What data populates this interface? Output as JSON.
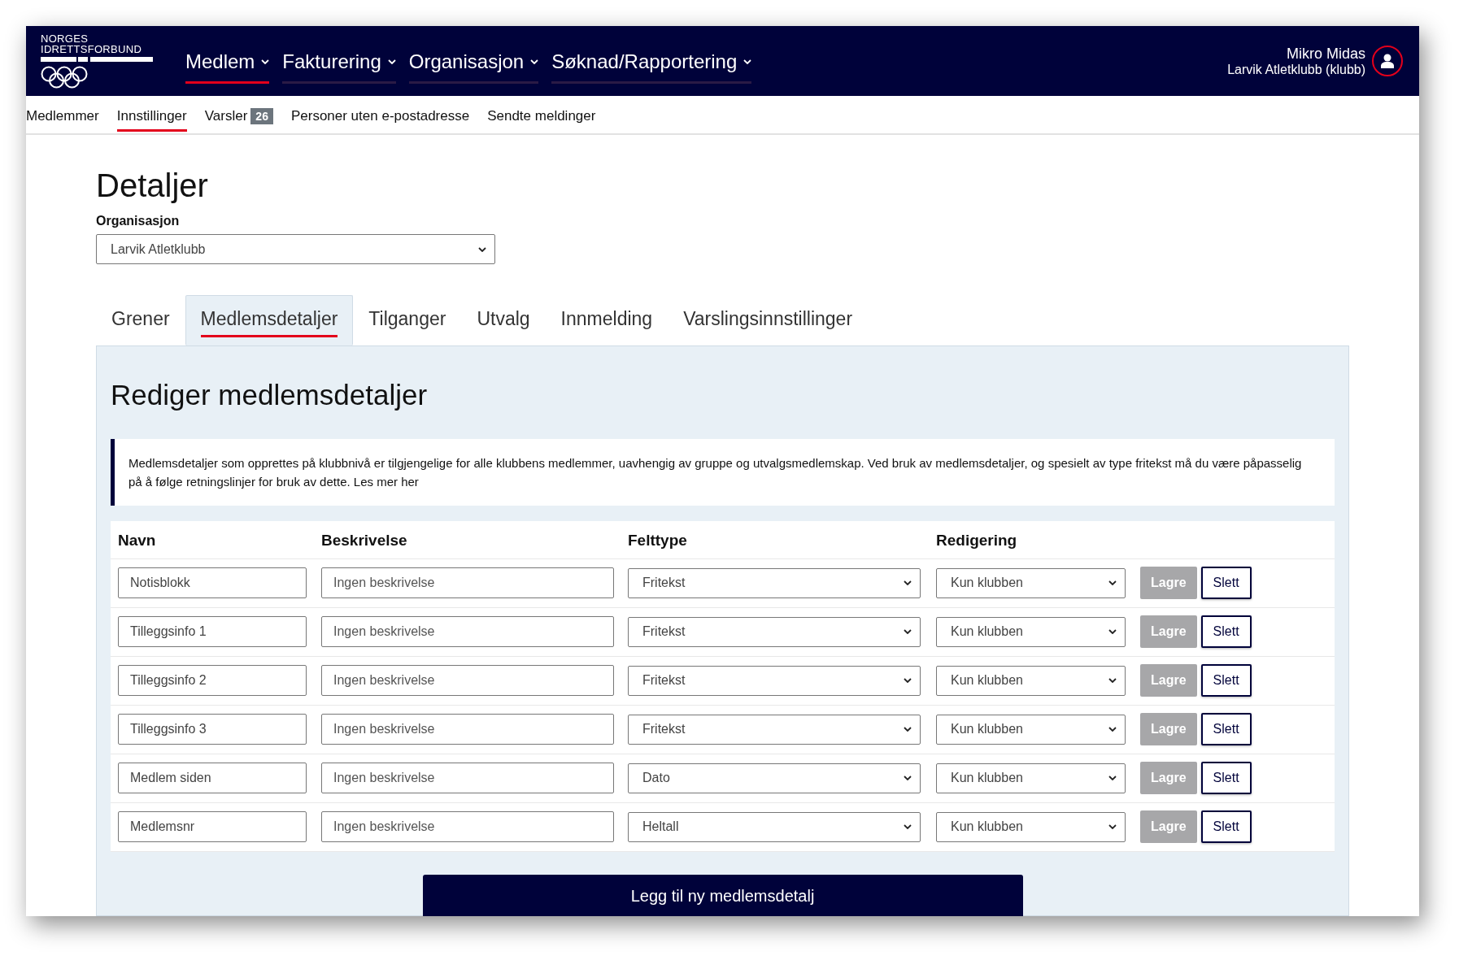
{
  "header": {
    "logo_lines": [
      "NORGES",
      "IDRETTSFORBUND"
    ],
    "nav": [
      {
        "label": "Medlem",
        "selected": true
      },
      {
        "label": "Fakturering",
        "selected": false
      },
      {
        "label": "Organisasjon",
        "selected": false
      },
      {
        "label": "Søknad/Rapportering",
        "selected": false
      }
    ],
    "user": {
      "name": "Mikro Midas",
      "org": "Larvik Atletklubb (klubb)"
    }
  },
  "subnav": [
    {
      "label": "Medlemmer",
      "selected": false
    },
    {
      "label": "Innstillinger",
      "selected": true
    },
    {
      "label": "Varsler",
      "selected": false,
      "badge": "26"
    },
    {
      "label": "Personer uten e-postadresse",
      "selected": false
    },
    {
      "label": "Sendte meldinger",
      "selected": false
    }
  ],
  "page": {
    "title": "Detaljer",
    "org_label": "Organisasjon",
    "org_value": "Larvik Atletklubb"
  },
  "tabs": [
    {
      "label": "Grener",
      "selected": false
    },
    {
      "label": "Medlemsdetaljer",
      "selected": true
    },
    {
      "label": "Tilganger",
      "selected": false
    },
    {
      "label": "Utvalg",
      "selected": false
    },
    {
      "label": "Innmelding",
      "selected": false
    },
    {
      "label": "Varslingsinnstillinger",
      "selected": false
    }
  ],
  "panel": {
    "heading": "Rediger medlemsdetaljer",
    "info": "Medlemsdetaljer som opprettes på klubbnivå er tilgjengelige for alle klubbens medlemmer, uavhengig av gruppe og utvalgsmedlemskap. Ved bruk av medlemsdetaljer, og spesielt av type fritekst må du være påpasselig på å følge retningslinjer for bruk av dette. Les mer her",
    "table": {
      "columns": [
        "Navn",
        "Beskrivelse",
        "Felttype",
        "Redigering"
      ],
      "rows": [
        {
          "name": "Notisblokk",
          "description_placeholder": "Ingen beskrivelse",
          "field_type": "Fritekst",
          "editing": "Kun klubben",
          "save": "Lagre",
          "save_disabled": true,
          "delete": "Slett"
        },
        {
          "name": "Tilleggsinfo 1",
          "description_placeholder": "Ingen beskrivelse",
          "field_type": "Fritekst",
          "editing": "Kun klubben",
          "save": "Lagre",
          "save_disabled": true,
          "delete": "Slett"
        },
        {
          "name": "Tilleggsinfo 2",
          "description_placeholder": "Ingen beskrivelse",
          "field_type": "Fritekst",
          "editing": "Kun klubben",
          "save": "Lagre",
          "save_disabled": true,
          "delete": "Slett"
        },
        {
          "name": "Tilleggsinfo 3",
          "description_placeholder": "Ingen beskrivelse",
          "field_type": "Fritekst",
          "editing": "Kun klubben",
          "save": "Lagre",
          "save_disabled": true,
          "delete": "Slett"
        },
        {
          "name": "Medlem siden",
          "description_placeholder": "Ingen beskrivelse",
          "field_type": "Dato",
          "editing": "Kun klubben",
          "save": "Lagre",
          "save_disabled": true,
          "delete": "Slett"
        },
        {
          "name": "Medlemsnr",
          "description_placeholder": "Ingen beskrivelse",
          "field_type": "Heltall",
          "editing": "Kun klubben",
          "save": "Lagre",
          "save_disabled": true,
          "delete": "Slett"
        }
      ]
    },
    "add_button": "Legg til ny medlemsdetalj"
  }
}
